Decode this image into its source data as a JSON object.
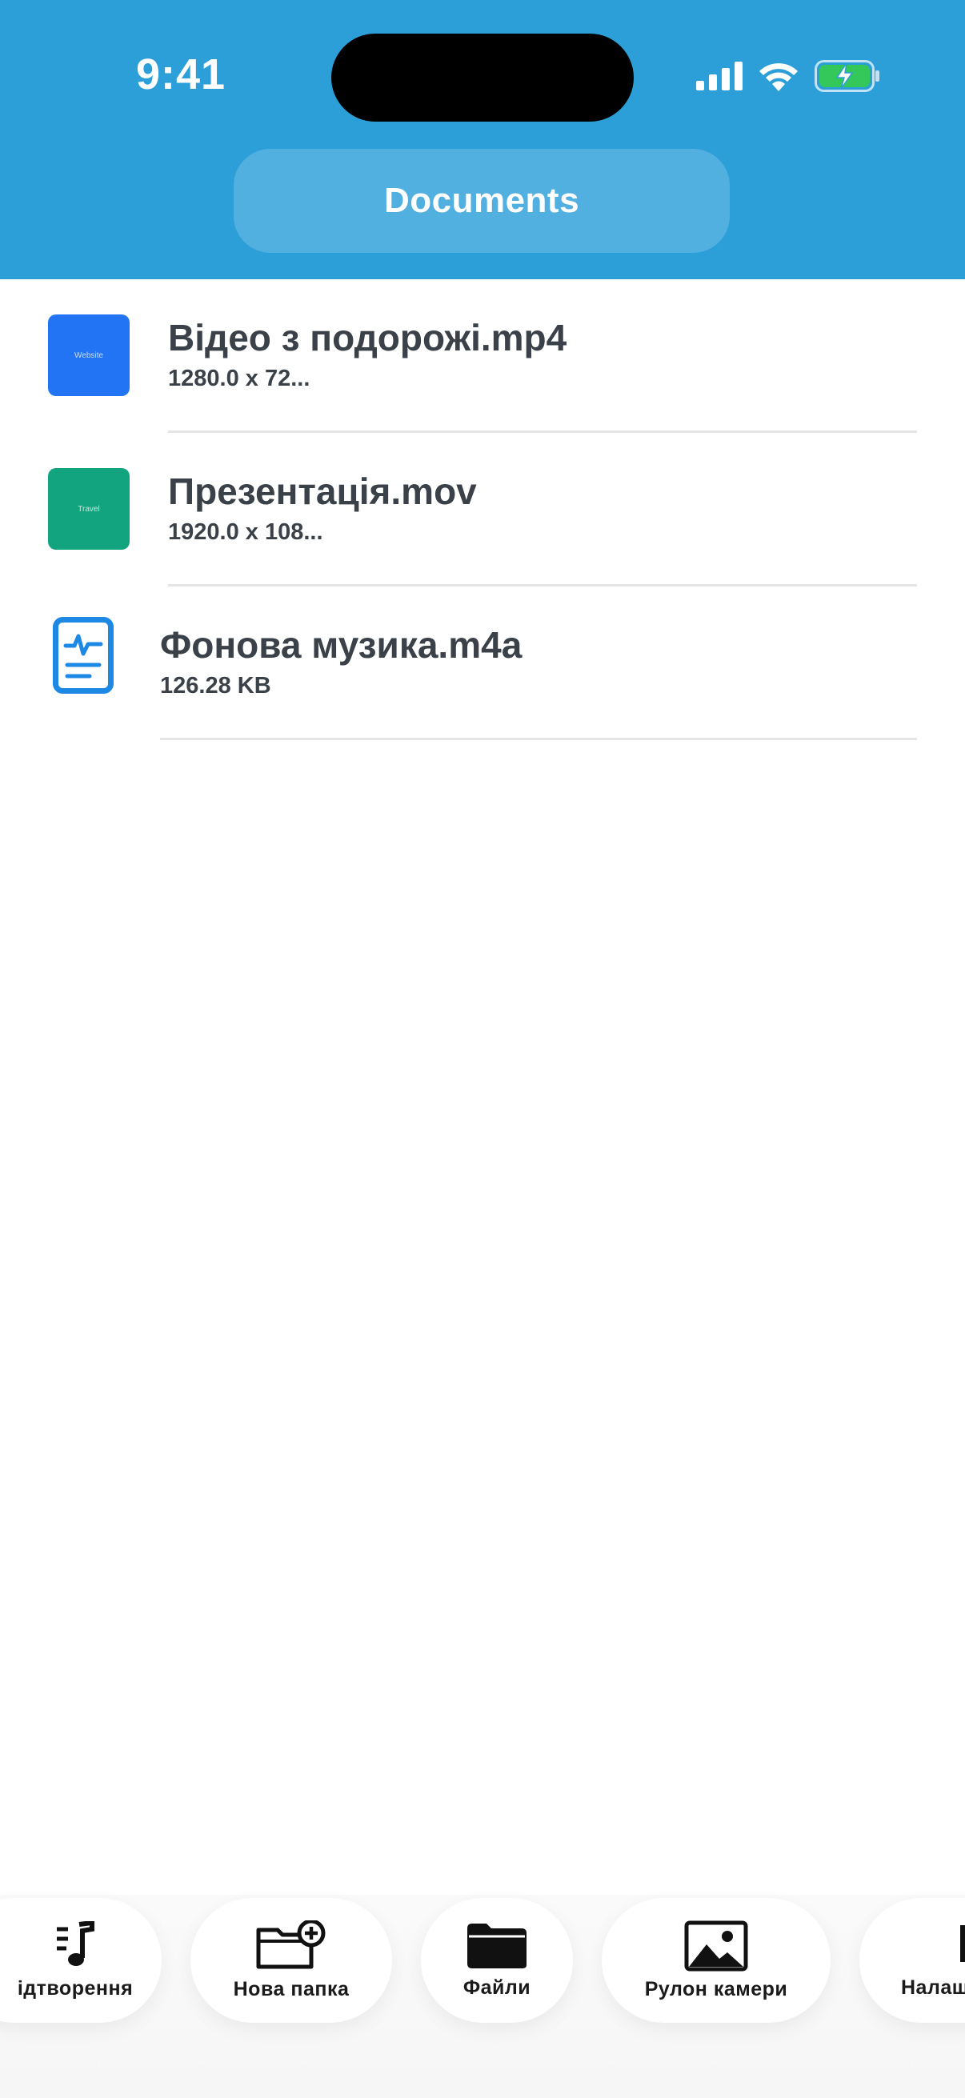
{
  "status_bar": {
    "time": "9:41"
  },
  "header": {
    "title": "Documents",
    "background": "#2c9fd9"
  },
  "files": [
    {
      "name": "Відео з подорожі.mp4",
      "meta": "1280.0 x 72...",
      "thumb_label": "Website",
      "thumb_color": "#2274f5",
      "icon": "video-thumbnail"
    },
    {
      "name": "Презентація.mov",
      "meta": "1920.0 x 108...",
      "thumb_label": "Travel",
      "thumb_color": "#12a37f",
      "icon": "video-thumbnail"
    },
    {
      "name": "Фонова музика.m4a",
      "meta": "126.28 KB",
      "icon": "audio-file-icon",
      "icon_color": "#1e88e5"
    }
  ],
  "toolbar": {
    "playback_label": "ідтворення",
    "new_folder_label": "Нова папка",
    "files_label": "Файли",
    "camera_roll_label": "Рулон камери",
    "settings_label": "Налащ"
  }
}
